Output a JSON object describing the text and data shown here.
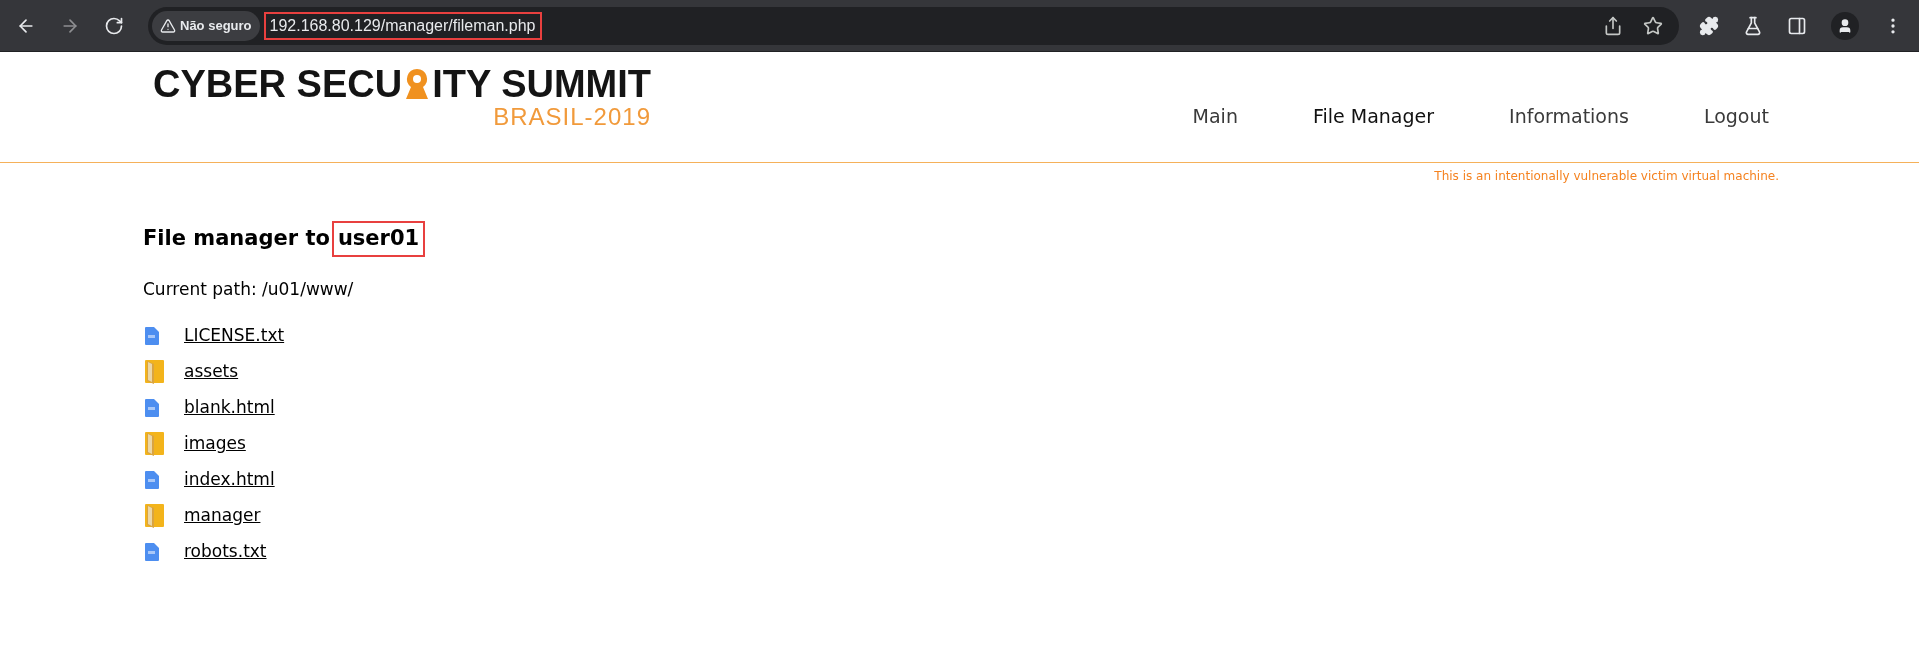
{
  "browser": {
    "security_label": "Não seguro",
    "url": "192.168.80.129/manager/fileman.php",
    "url_highlighted": true
  },
  "logo": {
    "text_before": "CYBER SECU",
    "text_after": "ITY SUMMIT",
    "subtitle": "BRASIL-2019"
  },
  "nav": [
    {
      "label": "Main",
      "selected": false
    },
    {
      "label": "File Manager",
      "selected": true
    },
    {
      "label": "Informations",
      "selected": false
    },
    {
      "label": "Logout",
      "selected": false
    }
  ],
  "notice": "This is an intentionally vulnerable victim virtual machine.",
  "heading": {
    "text": "File manager to",
    "user": "user01",
    "user_highlighted": true
  },
  "current_path": "Current path: /u01/www/",
  "files": [
    {
      "name": "LICENSE.txt",
      "kind": "file"
    },
    {
      "name": "assets",
      "kind": "folder"
    },
    {
      "name": "blank.html",
      "kind": "file"
    },
    {
      "name": "images",
      "kind": "folder"
    },
    {
      "name": "index.html",
      "kind": "file"
    },
    {
      "name": "manager",
      "kind": "folder"
    },
    {
      "name": "robots.txt",
      "kind": "file"
    }
  ]
}
